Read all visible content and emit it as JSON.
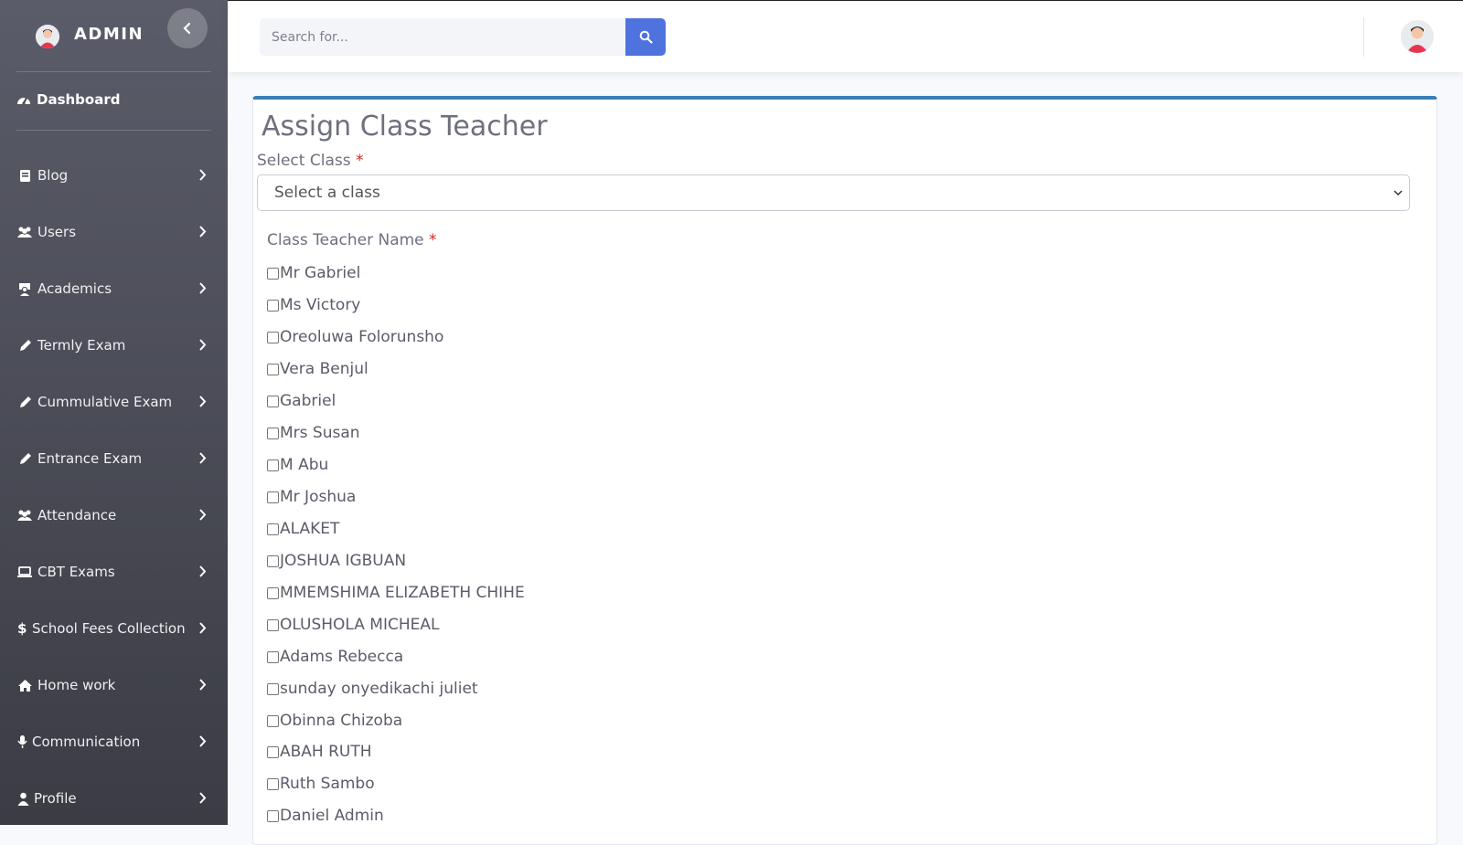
{
  "sidebar": {
    "brand": "ADMIN",
    "dashboard_label": "Dashboard",
    "items": [
      {
        "label": "Blog",
        "icon": "book-icon"
      },
      {
        "label": "Users",
        "icon": "users-icon"
      },
      {
        "label": "Academics",
        "icon": "teacher-icon"
      },
      {
        "label": "Termly Exam",
        "icon": "pencil-icon"
      },
      {
        "label": "Cummulative Exam",
        "icon": "pencil-icon"
      },
      {
        "label": "Entrance Exam",
        "icon": "pencil-icon"
      },
      {
        "label": "Attendance",
        "icon": "users-icon"
      },
      {
        "label": "CBT Exams",
        "icon": "laptop-icon"
      },
      {
        "label": "School Fees Collection",
        "icon": "dollar-icon"
      },
      {
        "label": "Home work",
        "icon": "home-icon"
      },
      {
        "label": "Communication",
        "icon": "microphone-icon"
      },
      {
        "label": "Profile",
        "icon": "user-icon"
      }
    ]
  },
  "topbar": {
    "search_placeholder": "Search for..."
  },
  "form": {
    "title": "Assign Class Teacher",
    "select_class_label": "Select Class",
    "required_mark": "*",
    "select_value": "Select a class",
    "teacher_label": "Class Teacher Name",
    "teachers": [
      "Mr Gabriel",
      "Ms Victory",
      "Oreoluwa Folorunsho",
      "Vera Benjul",
      "Gabriel",
      "Mrs Susan",
      "M Abu",
      "Mr Joshua",
      "ALAKET",
      "JOSHUA IGBUAN",
      "MMEMSHIMA ELIZABETH CHIHE",
      "OLUSHOLA MICHEAL",
      "Adams Rebecca",
      "sunday onyedikachi juliet",
      "Obinna Chizoba",
      "ABAH RUTH",
      "Ruth Sambo",
      "Daniel Admin"
    ]
  },
  "colors": {
    "accent": "#4e73df",
    "card_border_top": "#3a7fb8",
    "required": "#e02020"
  }
}
